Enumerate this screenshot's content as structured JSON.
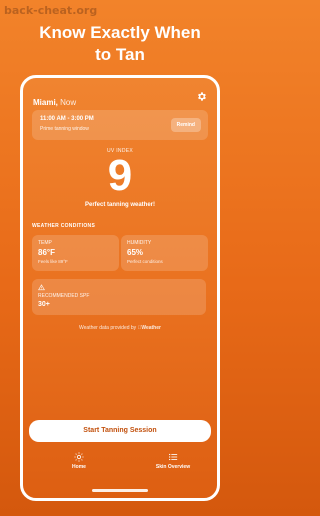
{
  "watermark": "back-cheat.org",
  "headline": {
    "line1": "Know Exactly When",
    "line2": "to Tan"
  },
  "location": {
    "city": "Miami,",
    "when": "Now"
  },
  "tanning_window": {
    "time": "11:00 AM - 3:00 PM",
    "desc": "Prime tanning window",
    "remind_label": "Remind"
  },
  "uv": {
    "label": "UV INDEX",
    "value": "9",
    "message": "Perfect tanning weather!"
  },
  "weather": {
    "section_title": "WEATHER CONDITIONS",
    "temp": {
      "label": "TEMP",
      "value": "86°F",
      "sub": "Feels like 89°F"
    },
    "humidity": {
      "label": "HUMIDITY",
      "value": "65%",
      "sub": "Perfect conditions"
    }
  },
  "spf": {
    "label": "RECOMMENDED SPF",
    "value": "30+"
  },
  "provider": {
    "prefix": "Weather data provided by",
    "brand": "Weather"
  },
  "start_button": "Start Tanning Session",
  "tabs": [
    {
      "label": "Home",
      "icon": "sun-icon"
    },
    {
      "label": "Skin Overview",
      "icon": "list-icon"
    }
  ],
  "colors": {
    "accent": "#E86A18",
    "button_text": "#C2500C"
  }
}
